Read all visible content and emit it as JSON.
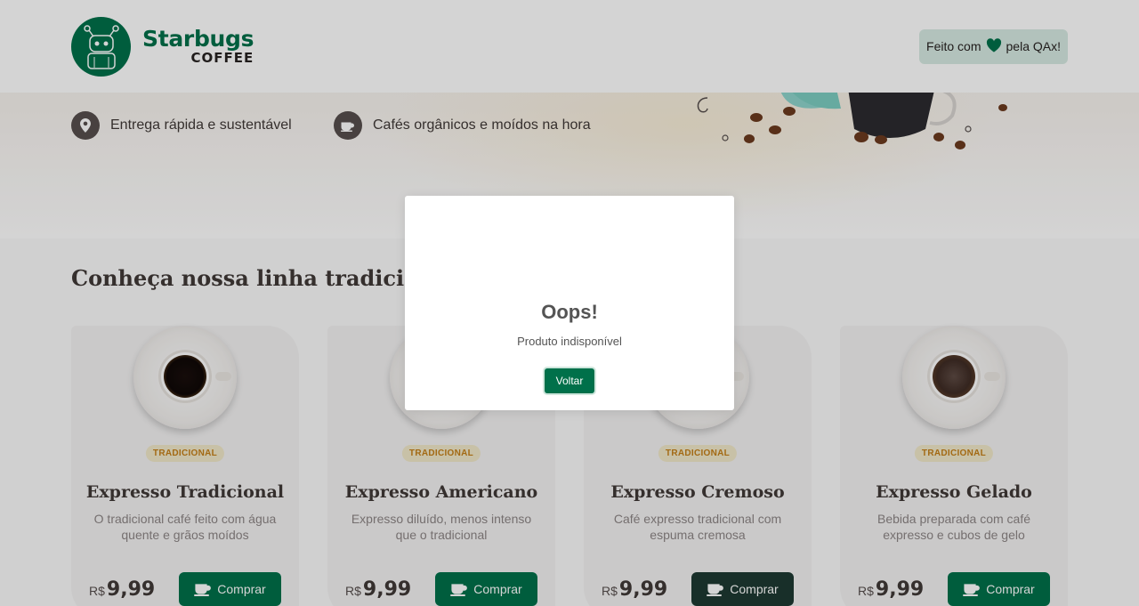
{
  "header": {
    "logo_title": "Starbugs",
    "logo_sub": "COFFEE",
    "made_with_prefix": "Feito com",
    "made_with_suffix": "pela QAx!",
    "heart_icon": "heart-icon",
    "brand_color": "#00704a"
  },
  "hero": {
    "features": [
      {
        "label": "Entrega rápida e sustentável",
        "icon": "location-pin-icon"
      },
      {
        "label": "Cafés orgânicos e moídos na hora",
        "icon": "coffee-cup-icon"
      }
    ]
  },
  "products": {
    "section_title": "Conheça nossa linha tradicional",
    "currency": "R$",
    "buy_label": "Comprar",
    "items": [
      {
        "tag": "TRADICIONAL",
        "name": "Expresso Tradicional",
        "description": "O tradicional café feito com água quente e grãos moídos",
        "price": "9,99"
      },
      {
        "tag": "TRADICIONAL",
        "name": "Expresso Americano",
        "description": "Expresso diluído, menos intenso que o tradicional",
        "price": "9,99"
      },
      {
        "tag": "TRADICIONAL",
        "name": "Expresso Cremoso",
        "description": "Café expresso tradicional com espuma cremosa",
        "price": "9,99"
      },
      {
        "tag": "TRADICIONAL",
        "name": "Expresso Gelado",
        "description": "Bebida preparada com café expresso e cubos de gelo",
        "price": "9,99"
      }
    ]
  },
  "modal": {
    "title": "Oops!",
    "message": "Produto indisponível",
    "button_label": "Voltar"
  }
}
